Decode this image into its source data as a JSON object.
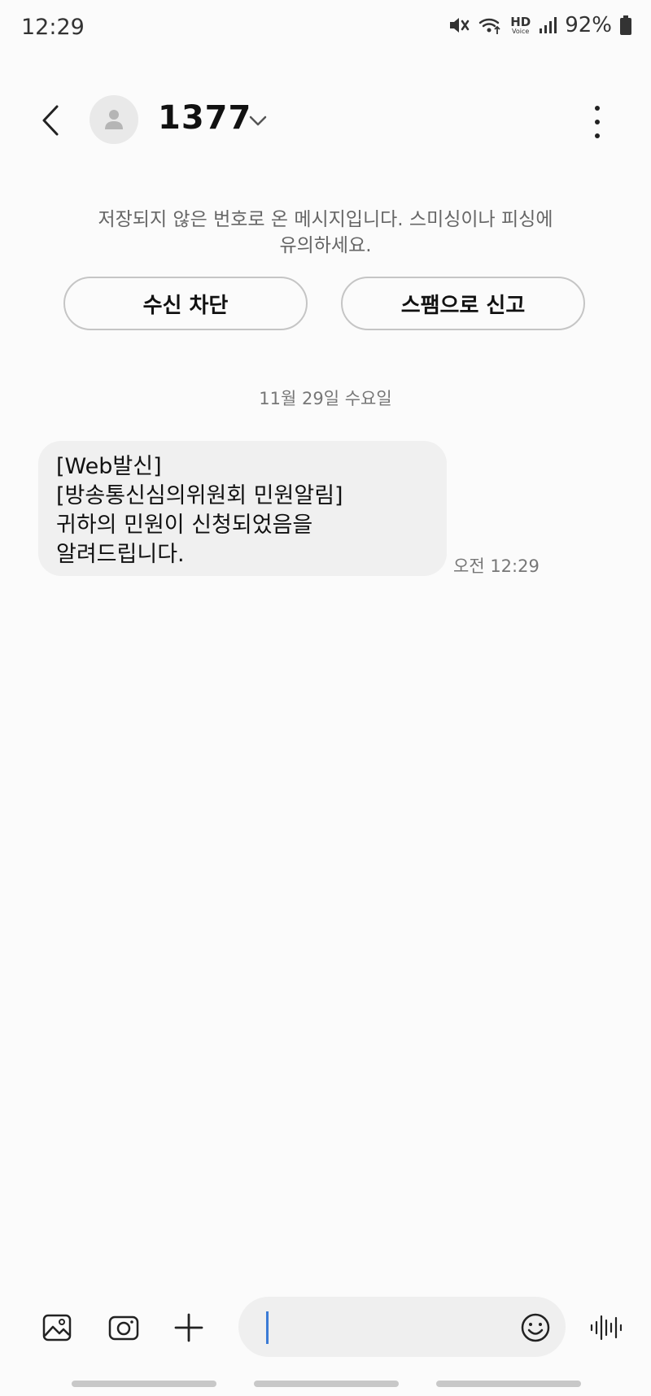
{
  "status_bar": {
    "time": "12:29",
    "hd_label": "HD",
    "voice_label": "Voice",
    "battery_percent": "92%",
    "icons": [
      "mute-icon",
      "wifi-icon",
      "hd-voice-icon",
      "signal-icon",
      "battery-icon"
    ]
  },
  "header": {
    "contact_name": "1377",
    "icons": [
      "back-icon",
      "avatar-icon",
      "chevron-down-icon",
      "more-icon"
    ]
  },
  "warning": {
    "line1": "저장되지 않은 번호로 온 메시지입니다. 스미싱이나 피싱에",
    "line2": "유의하세요.",
    "block_label": "수신 차단",
    "spam_label": "스팸으로 신고"
  },
  "conversation": {
    "date": "11월 29일 수요일",
    "messages": [
      {
        "lines": [
          "[Web발신]",
          "[방송통신심의위원회 민원알림]",
          "귀하의 민원이 신청되었음을",
          "알려드립니다."
        ],
        "time": "오전 12:29"
      }
    ]
  },
  "composer": {
    "icons": [
      "gallery-icon",
      "camera-icon",
      "plus-icon",
      "emoji-icon",
      "voice-wave-icon"
    ],
    "input_value": "",
    "accent_color": "#3b7bd6"
  }
}
